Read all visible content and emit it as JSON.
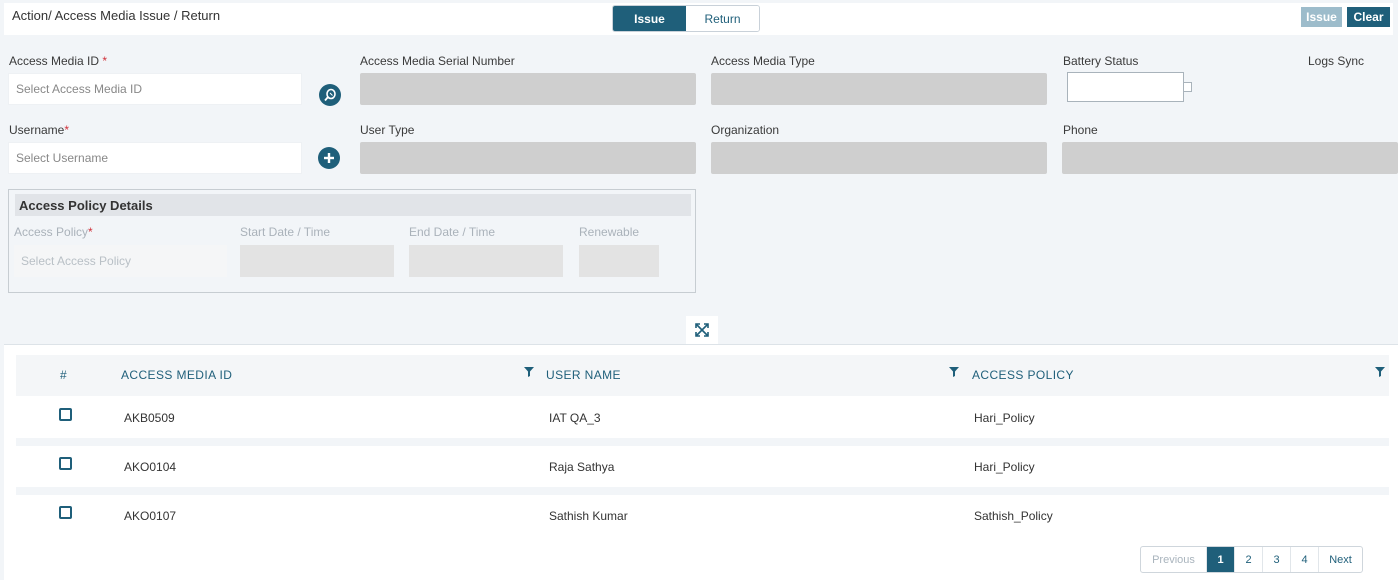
{
  "breadcrumb": "Action/ Access Media Issue / Return",
  "mode_tabs": [
    "Issue",
    "Return"
  ],
  "actions": {
    "issue": "Issue",
    "clear": "Clear"
  },
  "form": {
    "access_media_id": {
      "label": "Access Media ID",
      "required": "*",
      "placeholder": "Select Access Media ID"
    },
    "serial_number": {
      "label": "Access Media Serial Number"
    },
    "media_type": {
      "label": "Access Media Type"
    },
    "battery_status": {
      "label": "Battery Status"
    },
    "logs_sync": {
      "label": "Logs Sync"
    },
    "username": {
      "label": "Username",
      "required": "*",
      "placeholder": "Select Username"
    },
    "user_type": {
      "label": "User Type"
    },
    "organization": {
      "label": "Organization"
    },
    "phone": {
      "label": "Phone"
    }
  },
  "policy": {
    "title": "Access Policy Details",
    "access_policy": {
      "label": "Access Policy",
      "required": "*",
      "placeholder": "Select Access Policy"
    },
    "start": {
      "label": "Start Date / Time"
    },
    "end": {
      "label": "End Date / Time"
    },
    "renewable": {
      "label": "Renewable"
    }
  },
  "table": {
    "headers": [
      "#",
      "ACCESS MEDIA ID",
      "USER NAME",
      "ACCESS POLICY"
    ],
    "rows": [
      {
        "media_id": "AKB0509",
        "user": "IAT QA_3",
        "policy": "Hari_Policy"
      },
      {
        "media_id": "AKO0104",
        "user": "Raja Sathya",
        "policy": "Hari_Policy"
      },
      {
        "media_id": "AKO0107",
        "user": "Sathish Kumar",
        "policy": "Sathish_Policy"
      }
    ]
  },
  "pagination": {
    "previous": "Previous",
    "pages": [
      "1",
      "2",
      "3",
      "4"
    ],
    "next": "Next",
    "current": "1"
  },
  "colors": {
    "primary": "#1f5f7a",
    "disabled_button": "#9dbccb",
    "required": "#d0313a",
    "readonly_field": "#cfcfcf"
  }
}
